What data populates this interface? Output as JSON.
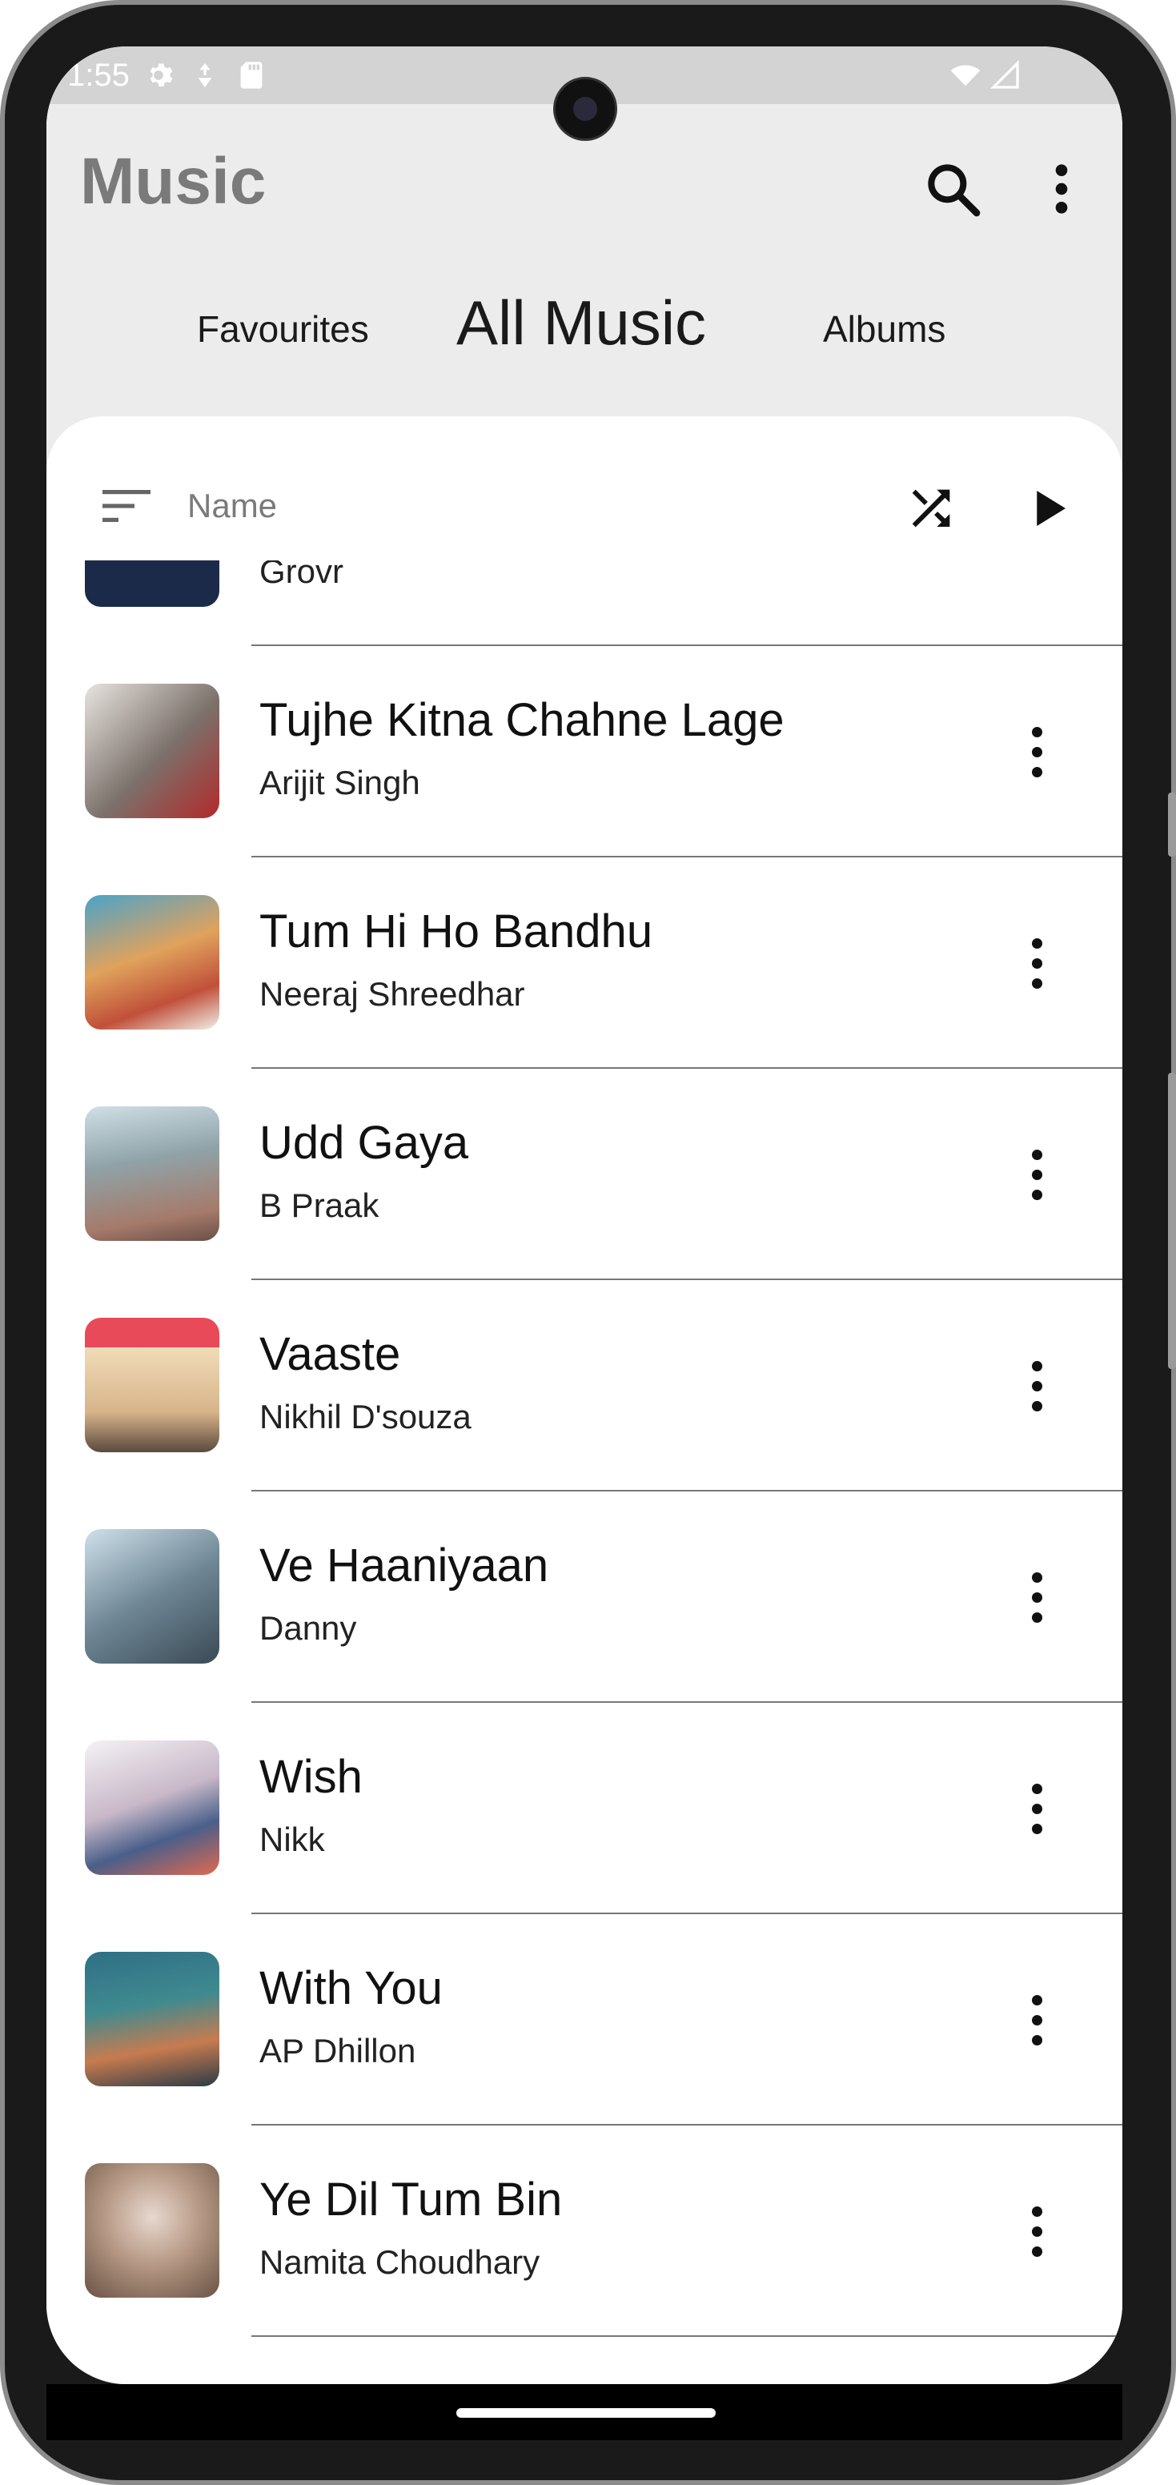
{
  "status_bar": {
    "time": "1:55"
  },
  "header": {
    "title": "Music",
    "tabs": [
      {
        "label": "Favourites"
      },
      {
        "label": "All Music"
      },
      {
        "label": "Albums"
      }
    ]
  },
  "sort": {
    "label": "Name"
  },
  "songs": [
    {
      "title": "",
      "artist": "Grovr",
      "art_color": "#1b2a48"
    },
    {
      "title": "Tujhe Kitna Chahne Lage",
      "artist": "Arijit Singh",
      "art_color": "#9a8f86"
    },
    {
      "title": "Tum Hi Ho Bandhu",
      "artist": "Neeraj Shreedhar",
      "art_color": "#d98a4e"
    },
    {
      "title": "Udd Gaya",
      "artist": "B Praak",
      "art_color": "#8fa3a8"
    },
    {
      "title": "Vaaste",
      "artist": "Nikhil D'souza",
      "art_color": "#e7c88a"
    },
    {
      "title": "Ve Haaniyaan",
      "artist": "Danny",
      "art_color": "#6f8796"
    },
    {
      "title": "Wish",
      "artist": "Nikk",
      "art_color": "#c8b8c8"
    },
    {
      "title": "With You",
      "artist": "AP Dhillon",
      "art_color": "#3f8a8f"
    },
    {
      "title": "Ye Dil Tum Bin",
      "artist": "Namita Choudhary",
      "art_color": "#b79a86"
    }
  ]
}
